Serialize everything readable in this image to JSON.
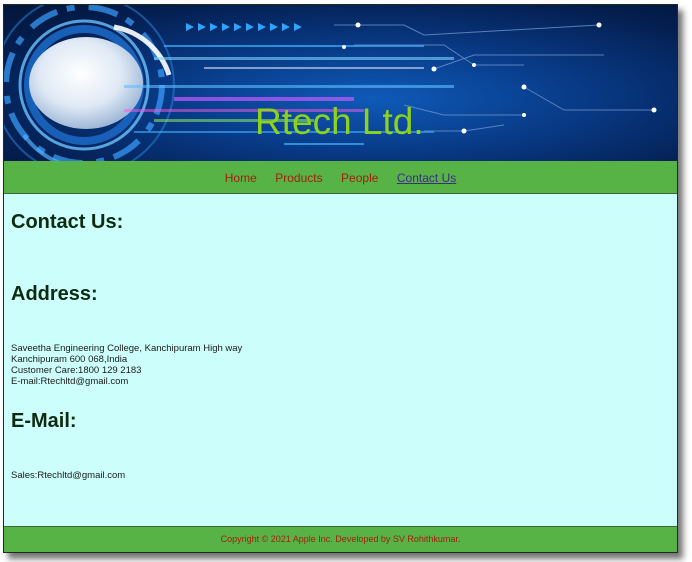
{
  "site": {
    "title": "Rtech Ltd."
  },
  "nav": {
    "items": [
      {
        "label": "Home"
      },
      {
        "label": "Products"
      },
      {
        "label": "People"
      },
      {
        "label": "Contact Us"
      }
    ],
    "active": "Contact Us"
  },
  "main": {
    "heading": "Contact Us:",
    "address_heading": "Address:",
    "address_lines": [
      "Saveetha Engineering College, Kanchipuram High way",
      "Kanchipuram 600 068,India",
      "Customer Care:1800 129 2183",
      "E-mail:Rtechltd@gmail.com"
    ],
    "email_heading": "E-Mail:",
    "email_lines": [
      "Sales:Rtechltd@gmail.com"
    ]
  },
  "footer": {
    "text": "Copyright © 2021 Apple Inc. Developed by SV Rohithkumar."
  },
  "colors": {
    "content_bg": "#ccfffb",
    "nav_bg": "#58b347",
    "nav_link": "#a3200b",
    "nav_active": "#3c2a8c",
    "title": "#8fd21c"
  }
}
